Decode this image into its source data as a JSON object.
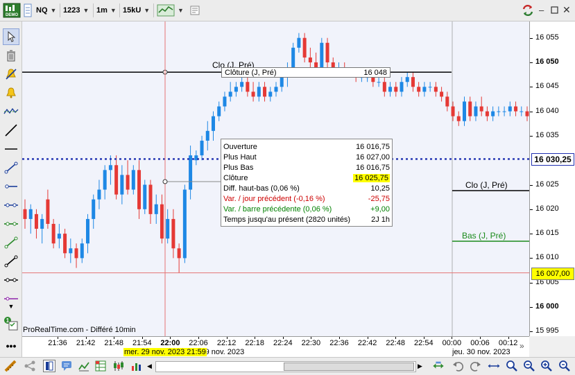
{
  "toolbar": {
    "demo_label": "DEMO",
    "instrument": "NQ",
    "units": "1223",
    "period": "1m",
    "ticks": "15kU"
  },
  "chart": {
    "watermark": "ProRealTime.com - Différé 10min",
    "current_price_label": "16 030,25",
    "crosshair_price_label": "16 007,00",
    "crosshair_time_label": "mer. 29 nov. 2023 21:59",
    "clo_label_top": "Clo (J, Pré)",
    "clo_label_right": "Clo (J, Pré)",
    "bas_label_right": "Bas (J, Pré)",
    "cloture_tip_label": "Clôture (J, Pré)",
    "cloture_tip_value": "16 048"
  },
  "price_axis": [
    {
      "value": 16055,
      "label": "16 055",
      "bold": false
    },
    {
      "value": 16050,
      "label": "16 050",
      "bold": true
    },
    {
      "value": 16045,
      "label": "16 045",
      "bold": false
    },
    {
      "value": 16040,
      "label": "16 040",
      "bold": false
    },
    {
      "value": 16035,
      "label": "16 035",
      "bold": false
    },
    {
      "value": 16025,
      "label": "16 025",
      "bold": false
    },
    {
      "value": 16020,
      "label": "16 020",
      "bold": false
    },
    {
      "value": 16015,
      "label": "16 015",
      "bold": false
    },
    {
      "value": 16010,
      "label": "16 010",
      "bold": false
    },
    {
      "value": 16005,
      "label": "16 005",
      "bold": false
    },
    {
      "value": 16000,
      "label": "16 000",
      "bold": true
    },
    {
      "value": 15995,
      "label": "15 995",
      "bold": false
    }
  ],
  "time_axis": [
    {
      "label": "21:36",
      "bold": false
    },
    {
      "label": "21:42",
      "bold": false
    },
    {
      "label": "21:48",
      "bold": false
    },
    {
      "label": "21:54",
      "bold": false
    },
    {
      "label": "22:00",
      "bold": true
    },
    {
      "label": "22:06",
      "bold": false
    },
    {
      "label": "22:12",
      "bold": false
    },
    {
      "label": "22:18",
      "bold": false
    },
    {
      "label": "22:24",
      "bold": false
    },
    {
      "label": "22:30",
      "bold": false
    },
    {
      "label": "22:36",
      "bold": false
    },
    {
      "label": "22:42",
      "bold": false
    },
    {
      "label": "22:48",
      "bold": false
    },
    {
      "label": "22:54",
      "bold": false
    },
    {
      "label": "00:00",
      "bold": false
    },
    {
      "label": "00:06",
      "bold": false
    },
    {
      "label": "00:12",
      "bold": false
    }
  ],
  "time_axis_dates": {
    "mid": "mer. 29 nov. 2023",
    "right": "jeu. 30 nov. 2023"
  },
  "info_box": {
    "rows": [
      {
        "label": "Ouverture",
        "value": "16 016,75",
        "color": "#000000"
      },
      {
        "label": "Plus Haut",
        "value": "16 027,00",
        "color": "#000000"
      },
      {
        "label": "Plus Bas",
        "value": "16 016,75",
        "color": "#000000"
      },
      {
        "label": "Clôture",
        "value": "16 025,75",
        "color": "#000000"
      },
      {
        "label": "Diff. haut-bas (0,06 %)",
        "value": "10,25",
        "color": "#000000"
      },
      {
        "label": "Var. / jour précédent (-0,16 %)",
        "value": "-25,75",
        "color": "#cc0000"
      },
      {
        "label": "Var. / barre précédente (0,06 %)",
        "value": "+9,00",
        "color": "#008000"
      },
      {
        "label": "Temps jusqu'au présent (2820 unités)",
        "value": "2J 1h",
        "color": "#000000"
      }
    ]
  },
  "colors": {
    "up": "#1e88e5",
    "down": "#e53935",
    "current_line": "#1f2fb0",
    "bas_line": "#1a8a1a",
    "highlight": "#ffff00"
  },
  "chart_data": {
    "type": "candlestick",
    "title": "",
    "instrument": "NQ",
    "interval": "1m",
    "ylim": [
      15993,
      16058
    ],
    "levels": {
      "cloture_jour_precedent": 16048,
      "current": 16030.25,
      "crosshair": 16007.0
    },
    "candles": [
      {
        "o": 16020,
        "h": 16022,
        "l": 16016,
        "c": 16018
      },
      {
        "o": 16018,
        "h": 16021,
        "l": 16015,
        "c": 16020
      },
      {
        "o": 16019,
        "h": 16020,
        "l": 16014,
        "c": 16016
      },
      {
        "o": 16016,
        "h": 16019,
        "l": 16013,
        "c": 16018
      },
      {
        "o": 16022,
        "h": 16024,
        "l": 16016,
        "c": 16017
      },
      {
        "o": 16017,
        "h": 16018,
        "l": 16012,
        "c": 16013
      },
      {
        "o": 16014,
        "h": 16017,
        "l": 16012,
        "c": 16015
      },
      {
        "o": 16015,
        "h": 16016,
        "l": 16010,
        "c": 16011
      },
      {
        "o": 16011,
        "h": 16014,
        "l": 16009,
        "c": 16012
      },
      {
        "o": 16012,
        "h": 16013,
        "l": 16008,
        "c": 16010
      },
      {
        "o": 16010,
        "h": 16014,
        "l": 16009,
        "c": 16013
      },
      {
        "o": 16013,
        "h": 16019,
        "l": 16011,
        "c": 16018
      },
      {
        "o": 16018,
        "h": 16023,
        "l": 16016,
        "c": 16022
      },
      {
        "o": 16022,
        "h": 16026,
        "l": 16020,
        "c": 16024
      },
      {
        "o": 16024,
        "h": 16029,
        "l": 16022,
        "c": 16028
      },
      {
        "o": 16028,
        "h": 16031,
        "l": 16025,
        "c": 16029
      },
      {
        "o": 16029,
        "h": 16031,
        "l": 16022,
        "c": 16023
      },
      {
        "o": 16023,
        "h": 16029,
        "l": 16021,
        "c": 16027
      },
      {
        "o": 16027,
        "h": 16030,
        "l": 16023,
        "c": 16024
      },
      {
        "o": 16024,
        "h": 16029,
        "l": 16023,
        "c": 16028
      },
      {
        "o": 16028,
        "h": 16030,
        "l": 16018,
        "c": 16020
      },
      {
        "o": 16020,
        "h": 16026,
        "l": 16019,
        "c": 16025
      },
      {
        "o": 16025,
        "h": 16026,
        "l": 16017,
        "c": 16019
      },
      {
        "o": 16019,
        "h": 16023,
        "l": 16017,
        "c": 16021
      },
      {
        "o": 16021,
        "h": 16023,
        "l": 16013,
        "c": 16014
      },
      {
        "o": 16014,
        "h": 16020,
        "l": 16013,
        "c": 16018
      },
      {
        "o": 16018,
        "h": 16020,
        "l": 16010,
        "c": 16012
      },
      {
        "o": 16012,
        "h": 16013,
        "l": 16007,
        "c": 16010
      },
      {
        "o": 16010,
        "h": 16025,
        "l": 16009,
        "c": 16024
      },
      {
        "o": 16024,
        "h": 16033,
        "l": 16022,
        "c": 16031
      },
      {
        "o": 16030,
        "h": 16032,
        "l": 16029,
        "c": 16031
      },
      {
        "o": 16031,
        "h": 16035,
        "l": 16030,
        "c": 16034
      },
      {
        "o": 16034,
        "h": 16038,
        "l": 16032,
        "c": 16036
      },
      {
        "o": 16036,
        "h": 16040,
        "l": 16034,
        "c": 16039
      },
      {
        "o": 16039,
        "h": 16042,
        "l": 16038,
        "c": 16041
      },
      {
        "o": 16041,
        "h": 16044,
        "l": 16040,
        "c": 16043
      },
      {
        "o": 16043,
        "h": 16046,
        "l": 16042,
        "c": 16044
      },
      {
        "o": 16044,
        "h": 16046,
        "l": 16043,
        "c": 16045
      },
      {
        "o": 16045,
        "h": 16047,
        "l": 16044,
        "c": 16046
      },
      {
        "o": 16046,
        "h": 16048,
        "l": 16043,
        "c": 16044
      },
      {
        "o": 16044,
        "h": 16046,
        "l": 16042,
        "c": 16043
      },
      {
        "o": 16043,
        "h": 16046,
        "l": 16042,
        "c": 16045
      },
      {
        "o": 16045,
        "h": 16046,
        "l": 16042,
        "c": 16043
      },
      {
        "o": 16043,
        "h": 16045,
        "l": 16042,
        "c": 16044
      },
      {
        "o": 16044,
        "h": 16046,
        "l": 16043,
        "c": 16045
      },
      {
        "o": 16045,
        "h": 16048,
        "l": 16044,
        "c": 16047
      },
      {
        "o": 16047,
        "h": 16050,
        "l": 16045,
        "c": 16049
      },
      {
        "o": 16049,
        "h": 16054,
        "l": 16047,
        "c": 16053
      },
      {
        "o": 16053,
        "h": 16056,
        "l": 16052,
        "c": 16055
      },
      {
        "o": 16055,
        "h": 16056,
        "l": 16050,
        "c": 16051
      },
      {
        "o": 16051,
        "h": 16053,
        "l": 16049,
        "c": 16050
      },
      {
        "o": 16050,
        "h": 16052,
        "l": 16048,
        "c": 16049
      },
      {
        "o": 16049,
        "h": 16055,
        "l": 16048,
        "c": 16054
      },
      {
        "o": 16054,
        "h": 16055,
        "l": 16049,
        "c": 16050
      },
      {
        "o": 16050,
        "h": 16051,
        "l": 16048,
        "c": 16049
      },
      {
        "o": 16049,
        "h": 16050,
        "l": 16048,
        "c": 16049
      },
      {
        "o": 16049,
        "h": 16050,
        "l": 16047,
        "c": 16048
      },
      {
        "o": 16048,
        "h": 16049,
        "l": 16047,
        "c": 16048
      },
      {
        "o": 16048,
        "h": 16049,
        "l": 16046,
        "c": 16047
      },
      {
        "o": 16047,
        "h": 16048,
        "l": 16046,
        "c": 16047
      },
      {
        "o": 16047,
        "h": 16048,
        "l": 16046,
        "c": 16047
      },
      {
        "o": 16047,
        "h": 16048,
        "l": 16045,
        "c": 16046
      },
      {
        "o": 16046,
        "h": 16047,
        "l": 16045,
        "c": 16046
      },
      {
        "o": 16046,
        "h": 16047,
        "l": 16043,
        "c": 16044
      },
      {
        "o": 16044,
        "h": 16046,
        "l": 16043,
        "c": 16045
      },
      {
        "o": 16045,
        "h": 16046,
        "l": 16043,
        "c": 16044
      },
      {
        "o": 16044,
        "h": 16047,
        "l": 16043,
        "c": 16046
      },
      {
        "o": 16046,
        "h": 16048,
        "l": 16045,
        "c": 16047
      },
      {
        "o": 16047,
        "h": 16048,
        "l": 16044,
        "c": 16045
      },
      {
        "o": 16045,
        "h": 16046,
        "l": 16043,
        "c": 16044
      },
      {
        "o": 16044,
        "h": 16046,
        "l": 16043,
        "c": 16045
      },
      {
        "o": 16045,
        "h": 16046,
        "l": 16044,
        "c": 16045
      },
      {
        "o": 16045,
        "h": 16046,
        "l": 16043,
        "c": 16044
      },
      {
        "o": 16044,
        "h": 16045,
        "l": 16042,
        "c": 16043
      },
      {
        "o": 16043,
        "h": 16044,
        "l": 16040,
        "c": 16041
      },
      {
        "o": 16041,
        "h": 16042,
        "l": 16038,
        "c": 16039
      },
      {
        "o": 16039,
        "h": 16040,
        "l": 16037,
        "c": 16038
      },
      {
        "o": 16038,
        "h": 16043,
        "l": 16037,
        "c": 16042
      },
      {
        "o": 16042,
        "h": 16043,
        "l": 16038,
        "c": 16039
      },
      {
        "o": 16039,
        "h": 16042,
        "l": 16038,
        "c": 16041
      },
      {
        "o": 16041,
        "h": 16043,
        "l": 16039,
        "c": 16040
      },
      {
        "o": 16040,
        "h": 16041,
        "l": 16038,
        "c": 16039
      },
      {
        "o": 16039,
        "h": 16041,
        "l": 16038,
        "c": 16040
      },
      {
        "o": 16040,
        "h": 16041,
        "l": 16039,
        "c": 16040
      },
      {
        "o": 16040,
        "h": 16041,
        "l": 16039,
        "c": 16040
      },
      {
        "o": 16040,
        "h": 16042,
        "l": 16039,
        "c": 16041
      },
      {
        "o": 16041,
        "h": 16042,
        "l": 16039,
        "c": 16040
      },
      {
        "o": 16040,
        "h": 16041,
        "l": 16039,
        "c": 16040
      },
      {
        "o": 16040,
        "h": 16041,
        "l": 16038,
        "c": 16039
      }
    ]
  }
}
